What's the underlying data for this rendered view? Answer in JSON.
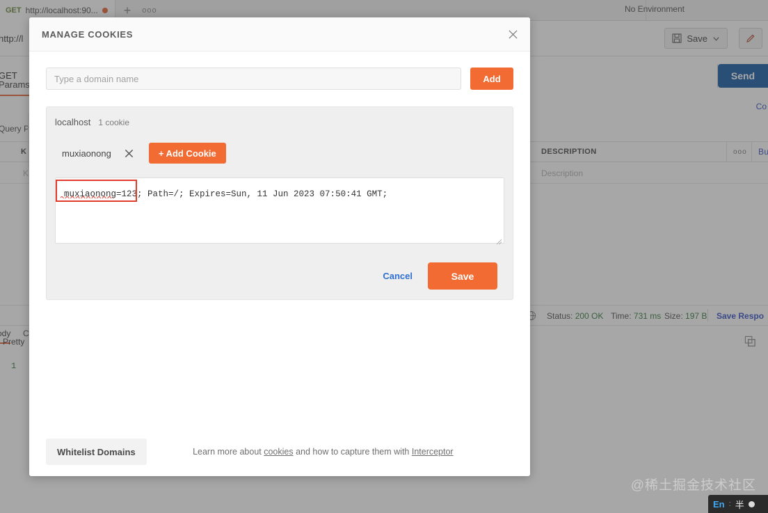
{
  "app": {
    "tab": {
      "method": "GET",
      "title": "http://localhost:90...",
      "unsaved_icon": "unsaved-dot",
      "new_tab_icon": "plus-icon",
      "more_icon": "ellipsis-icon"
    },
    "environment": {
      "label": "No Environment"
    },
    "toolbar": {
      "save_label": "Save",
      "save_icon": "floppy-disk-icon",
      "save_chevron_icon": "chevron-down-icon",
      "edit_icon": "pencil-icon"
    },
    "request": {
      "url": "http://l",
      "method": "GET",
      "send_label": "Send"
    },
    "req_tabs": [
      {
        "label": "Params",
        "active": true
      }
    ],
    "cookies_link": "Co",
    "query_params_label": "Query P",
    "table": {
      "headers": {
        "key": "K",
        "description": "DESCRIPTION",
        "more_icon": "ellipsis-icon",
        "bulk": "Bu"
      },
      "rows": [
        {
          "key": "K",
          "description": "Description"
        }
      ]
    },
    "status": {
      "globe_icon": "globe-icon",
      "status_label": "Status:",
      "status_value": "200 OK",
      "time_label": "Time:",
      "time_value": "731 ms",
      "size_label": "Size:",
      "size_value": "197 B",
      "save_response": "Save Respo"
    },
    "response": {
      "tab_body": "ody",
      "tab_cookies": "C",
      "pretty_label": "Pretty",
      "copy_icon": "copy-icon",
      "line_number": "1"
    },
    "watermark": "@稀土掘金技术社区",
    "ime": {
      "lang": "En",
      "separator": ":",
      "width_mode": "半",
      "dot_icon": "ime-dot-icon"
    }
  },
  "modal": {
    "title": "MANAGE COOKIES",
    "close_icon": "close-icon",
    "domain": {
      "placeholder": "Type a domain name",
      "value": "",
      "add_label": "Add"
    },
    "panel": {
      "domain": "localhost",
      "count": "1 cookie",
      "cookie_name": "muxiaonong",
      "remove_icon": "close-icon",
      "add_cookie_label": "+ Add Cookie"
    },
    "editor": {
      "value": "muxiaonong=123; Path=/; Expires=Sun, 11 Jun 2023 07:50:41 GMT;",
      "highlighted_fragment": "muxiaonong=123;",
      "resize_icon": "resize-grip-icon"
    },
    "actions": {
      "cancel_label": "Cancel",
      "save_label": "Save"
    },
    "footer": {
      "whitelist_label": "Whitelist Domains",
      "note_prefix": "Learn more about ",
      "note_link1": "cookies",
      "note_middle": " and how to capture them with ",
      "note_link2": "Interceptor"
    }
  },
  "colors": {
    "accent_orange": "#f26b33",
    "link_blue": "#3a56c7",
    "send_blue": "#1a5fa8",
    "highlight_red": "#e23b2e",
    "status_green": "#3a7d44"
  }
}
